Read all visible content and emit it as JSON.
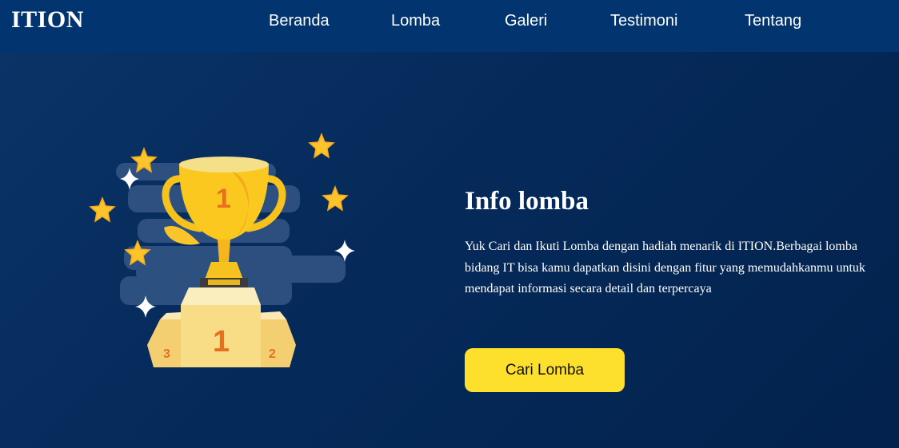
{
  "navbar": {
    "brand": "ITION",
    "links": [
      {
        "label": "Beranda"
      },
      {
        "label": "Lomba"
      },
      {
        "label": "Galeri"
      },
      {
        "label": "Testimoni"
      },
      {
        "label": "Tentang"
      }
    ]
  },
  "hero": {
    "title": "Info lomba",
    "description": "Yuk Cari dan Ikuti Lomba dengan hadiah menarik di ITION.Berbagai lomba bidang IT bisa kamu dapatkan disini dengan fitur yang memudahkanmu untuk mendapat informasi secara detail dan terpercaya",
    "cta_label": "Cari Lomba"
  },
  "illustration": {
    "trophy_number": "1",
    "podium_labels": {
      "first": "1",
      "second": "2",
      "third": "3"
    },
    "icons": [
      "trophy-icon",
      "podium-icon",
      "star-icon",
      "sparkle-icon"
    ]
  },
  "colors": {
    "navbar_bg": "#023470",
    "hero_bg": "#052a5a",
    "accent_yellow": "#fde02b",
    "text": "#ffffff"
  }
}
